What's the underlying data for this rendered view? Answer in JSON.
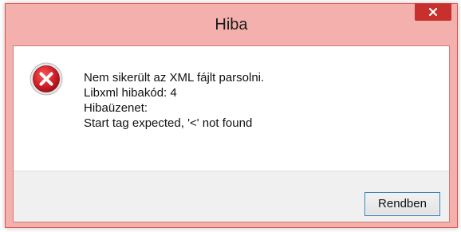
{
  "dialog": {
    "title": "Hiba",
    "close_icon": "close-icon",
    "error_icon": "error-icon",
    "message_lines": [
      "Nem sikerült az XML fájlt parsolni.",
      "Libxml hibakód: 4",
      "Hibaüzenet:",
      "Start tag expected, '<' not found"
    ],
    "ok_label": "Rendben"
  },
  "colors": {
    "titlebar_bg": "#f3b0ac",
    "close_button_bg": "#c7302c",
    "error_icon_red": "#d8222b",
    "button_border": "#3c7fb1"
  }
}
